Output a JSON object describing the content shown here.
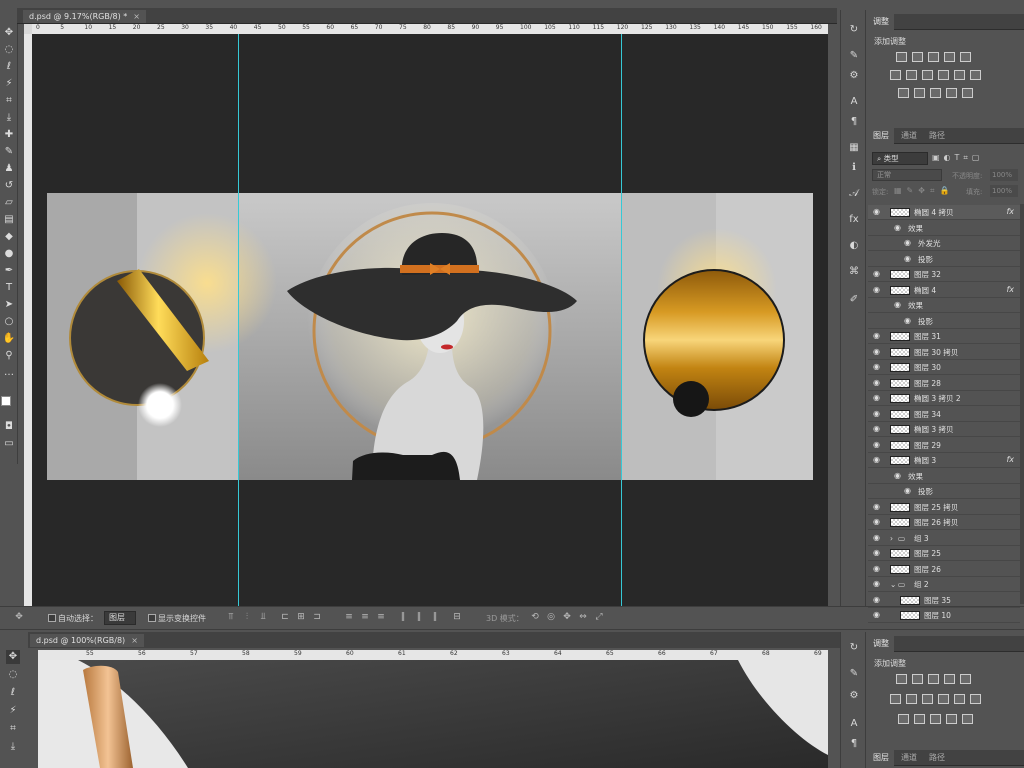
{
  "doc_tab": {
    "title": "d.psd @ 9.17%(RGB/8) *",
    "close": "×"
  },
  "ruler_top": [
    "0",
    "5",
    "10",
    "15",
    "20",
    "25",
    "30",
    "35",
    "40",
    "45",
    "50",
    "55",
    "60",
    "65",
    "70",
    "75",
    "80",
    "85",
    "90",
    "95",
    "100",
    "105",
    "110",
    "115",
    "120",
    "125",
    "130",
    "135",
    "140",
    "145",
    "150",
    "155",
    "160"
  ],
  "options_bar": {
    "auto_select_label": "自动选择：",
    "auto_select_value": "图层",
    "show_transform_label": "显示变换控件",
    "mode_label": "3D 模式："
  },
  "adjust_panel": {
    "tab": "调整",
    "title": "添加调整"
  },
  "layers_panel": {
    "tabs": [
      "图层",
      "通道",
      "路径"
    ],
    "filter_kind": "类型",
    "blend_mode": "正常",
    "opacity_label": "不透明度:",
    "opacity_value": "100%",
    "lock_label": "锁定:",
    "fill_label": "填充:",
    "fill_value": "100%",
    "rows": [
      {
        "name": "椭圆 4 拷贝",
        "fx": "fx",
        "type": "shape",
        "indent": 0
      },
      {
        "name": "效果",
        "type": "effect",
        "indent": 1
      },
      {
        "name": "外发光",
        "type": "effect",
        "indent": 2
      },
      {
        "name": "投影",
        "type": "effect",
        "indent": 2
      },
      {
        "name": "图层 32",
        "type": "pixel",
        "indent": 0
      },
      {
        "name": "椭圆 4",
        "fx": "fx",
        "type": "shape",
        "indent": 0
      },
      {
        "name": "效果",
        "type": "effect",
        "indent": 1
      },
      {
        "name": "投影",
        "type": "effect",
        "indent": 2
      },
      {
        "name": "图层 31",
        "type": "pixel",
        "indent": 0
      },
      {
        "name": "图层 30 拷贝",
        "type": "pixel",
        "indent": 0
      },
      {
        "name": "图层 30",
        "type": "pixel",
        "indent": 0
      },
      {
        "name": "图层 28",
        "type": "pixel",
        "indent": 0
      },
      {
        "name": "椭圆 3 拷贝 2",
        "type": "shape",
        "indent": 0
      },
      {
        "name": "图层 34",
        "type": "pixel",
        "indent": 0
      },
      {
        "name": "椭圆 3 拷贝",
        "type": "shape",
        "indent": 0
      },
      {
        "name": "图层 29",
        "type": "pixel",
        "indent": 0
      },
      {
        "name": "椭圆 3",
        "fx": "fx",
        "type": "shape",
        "indent": 0
      },
      {
        "name": "效果",
        "type": "effect",
        "indent": 1
      },
      {
        "name": "投影",
        "type": "effect",
        "indent": 2
      },
      {
        "name": "图层 25 拷贝",
        "type": "pixel",
        "indent": 0
      },
      {
        "name": "图层 26 拷贝",
        "type": "pixel",
        "indent": 0
      },
      {
        "name": "组 3",
        "type": "group",
        "indent": 0
      },
      {
        "name": "图层 25",
        "type": "pixel",
        "indent": 0
      },
      {
        "name": "图层 26",
        "type": "pixel",
        "indent": 0
      },
      {
        "name": "组 2",
        "type": "group-open",
        "indent": 0
      },
      {
        "name": "图层 35",
        "type": "pixel",
        "indent": 1
      },
      {
        "name": "图层 10",
        "type": "pixel",
        "indent": 1
      }
    ]
  },
  "doc_tab_2": {
    "title": "d.psd @ 100%(RGB/8)",
    "close": "×"
  },
  "ruler_bottom": [
    "55",
    "56",
    "57",
    "58",
    "59",
    "60",
    "61",
    "62",
    "63",
    "64",
    "65",
    "66",
    "67",
    "68",
    "69"
  ],
  "adjust_panel_2": {
    "tab": "调整",
    "title": "添加调整"
  },
  "layers_panel_2": {
    "tabs": [
      "图层",
      "通道",
      "路径"
    ]
  },
  "colors": {
    "accent_gold": "#d79a23",
    "guide_cyan": "#36c9d6",
    "hat_band": "#d2701f",
    "lips": "#c4282a"
  }
}
